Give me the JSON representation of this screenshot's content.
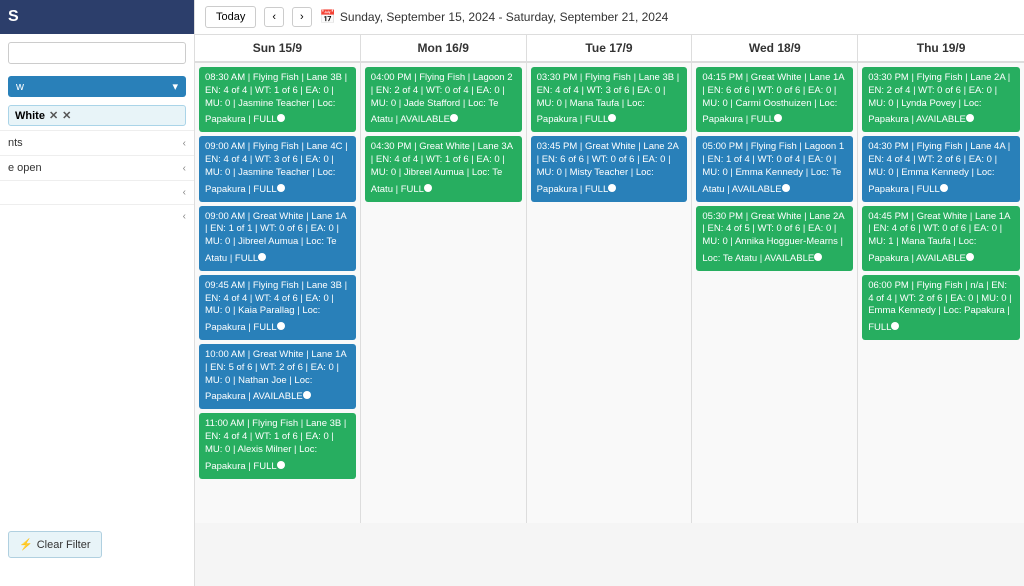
{
  "sidebar": {
    "title": "S",
    "search_placeholder": "",
    "dropdown_label": "w",
    "filter_tag": "White",
    "nav_items": [
      {
        "label": "nts",
        "id": "nts"
      },
      {
        "label": "e open",
        "id": "e-open"
      },
      {
        "label": "",
        "id": "item3"
      },
      {
        "label": "",
        "id": "item4"
      }
    ],
    "clear_filter_label": "Clear Filter"
  },
  "toolbar": {
    "today_label": "Today",
    "title": "Sunday, September 15, 2024 - Saturday, September 21, 2024"
  },
  "columns": [
    {
      "header": "Sun 15/9"
    },
    {
      "header": "Mon 16/9"
    },
    {
      "header": "Tue 17/9"
    },
    {
      "header": "Wed 18/9"
    },
    {
      "header": "Thu 19/9"
    }
  ],
  "events": {
    "sun": [
      {
        "color": "green",
        "text": "08:30 AM | Flying Fish | Lane 3B | EN: 4 of 4 | WT: 1 of 6 | EA: 0 | MU: 0 | Jasmine Teacher | Loc: Papakura | FULL",
        "dot": true
      },
      {
        "color": "blue",
        "text": "09:00 AM | Flying Fish | Lane 4C | EN: 4 of 4 | WT: 3 of 6 | EA: 0 | MU: 0 | Jasmine Teacher | Loc: Papakura | FULL",
        "dot": true
      },
      {
        "color": "blue",
        "text": "09:00 AM | Great White | Lane 1A | EN: 1 of 1 | WT: 0 of 6 | EA: 0 | MU: 0 | Jibreel Aumua | Loc: Te Atatu | FULL",
        "dot": true
      },
      {
        "color": "blue",
        "text": "09:45 AM | Flying Fish | Lane 3B | EN: 4 of 4 | WT: 4 of 6 | EA: 0 | MU: 0 | Kaia Parallag | Loc: Papakura | FULL",
        "dot": true
      },
      {
        "color": "blue",
        "text": "10:00 AM | Great White | Lane 1A | EN: 5 of 6 | WT: 2 of 6 | EA: 0 | MU: 0 | Nathan Joe | Loc: Papakura | AVAILABLE",
        "dot": true
      },
      {
        "color": "green",
        "text": "11:00 AM | Flying Fish | Lane 3B | EN: 4 of 4 | WT: 1 of 6 | EA: 0 | MU: 0 | Alexis Milner | Loc: Papakura | FULL",
        "dot": true
      }
    ],
    "mon": [
      {
        "color": "green",
        "text": "04:00 PM | Flying Fish | Lagoon 2 | EN: 2 of 4 | WT: 0 of 4 | EA: 0 | MU: 0 | Jade Stafford | Loc: Te Atatu | AVAILABLE",
        "dot": true
      },
      {
        "color": "green",
        "text": "04:30 PM | Great White | Lane 3A | EN: 4 of 4 | WT: 1 of 6 | EA: 0 | MU: 0 | Jibreel Aumua | Loc: Te Atatu | FULL",
        "dot": true
      }
    ],
    "tue": [
      {
        "color": "green",
        "text": "03:30 PM | Flying Fish | Lane 3B | EN: 4 of 4 | WT: 3 of 6 | EA: 0 | MU: 0 | Mana Taufa | Loc: Papakura | FULL",
        "dot": true
      },
      {
        "color": "blue",
        "text": "03:45 PM | Great White | Lane 2A | EN: 6 of 6 | WT: 0 of 6 | EA: 0 | MU: 0 | Misty Teacher | Loc: Papakura | FULL",
        "dot": true
      }
    ],
    "wed": [
      {
        "color": "green",
        "text": "04:15 PM | Great White | Lane 1A | EN: 6 of 6 | WT: 0 of 6 | EA: 0 | MU: 0 | Carmi Oosthuizen | Loc: Papakura | FULL",
        "dot": true
      },
      {
        "color": "blue",
        "text": "05:00 PM | Flying Fish | Lagoon 1 | EN: 1 of 4 | WT: 0 of 4 | EA: 0 | MU: 0 | Emma Kennedy | Loc: Te Atatu | AVAILABLE",
        "dot": true
      },
      {
        "color": "green",
        "text": "05:30 PM | Great White | Lane 2A | EN: 4 of 5 | WT: 0 of 6 | EA: 0 | MU: 0 | Annika Hogguer-Mearns | Loc: Te Atatu | AVAILABLE",
        "dot": true
      }
    ],
    "thu": [
      {
        "color": "green",
        "text": "03:30 PM | Flying Fish | Lane 2A | EN: 2 of 4 | WT: 0 of 6 | EA: 0 | MU: 0 | Lynda Povey | Loc: Papakura | AVAILABLE",
        "dot": true
      },
      {
        "color": "blue",
        "text": "04:30 PM | Flying Fish | Lane 4A | EN: 4 of 4 | WT: 2 of 6 | EA: 0 | MU: 0 | Emma Kennedy | Loc: Papakura | FULL",
        "dot": true
      },
      {
        "color": "green",
        "text": "04:45 PM | Great White | Lane 1A | EN: 4 of 6 | WT: 0 of 6 | EA: 0 | MU: 1 | Mana Taufa | Loc: Papakura | AVAILABLE",
        "dot": true
      },
      {
        "color": "green",
        "text": "06:00 PM | Flying Fish | n/a | EN: 4 of 4 | WT: 2 of 6 | EA: 0 | MU: 0 | Emma Kennedy | Loc: Papakura | FULL",
        "dot": true
      }
    ]
  },
  "icons": {
    "calendar": "📅",
    "filter": "⚡",
    "chevron_left": "‹",
    "chevron_right": "›",
    "chevron_small": "‹",
    "tag_close": "✕"
  }
}
